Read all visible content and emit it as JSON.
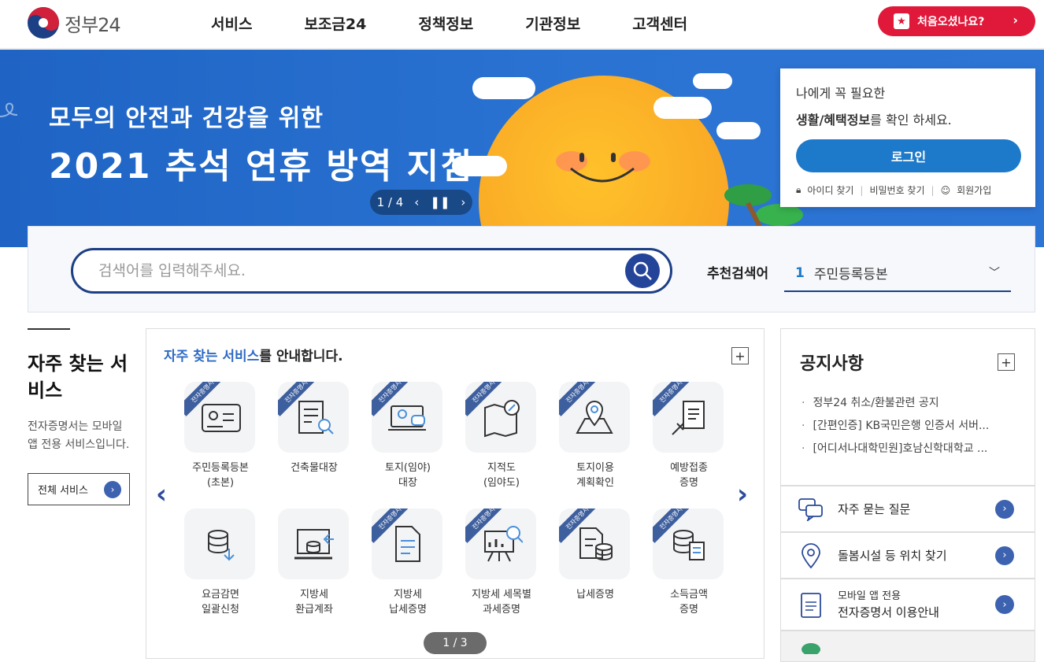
{
  "header": {
    "logo_text": "정부24",
    "nav": [
      "서비스",
      "보조금24",
      "정책정보",
      "기관정보",
      "고객센터"
    ],
    "first_visit_label": "처음오셨나요?"
  },
  "banner": {
    "title_line1": "모두의 안전과 건강을 위한",
    "title_line2": "2021 추석 연휴 방역 지침",
    "pager_text": "1 / 4"
  },
  "login": {
    "line1": "나에게 꼭 필요한",
    "line2_bold": "생활/혜택정보",
    "line2_rest": "를 확인 하세요.",
    "button": "로그인",
    "find_id": "아이디 찾기",
    "find_pw": "비밀번호 찾기",
    "signup": "회원가입"
  },
  "search": {
    "placeholder": "검색어를 입력해주세요.",
    "recommend_label": "추천검색어",
    "recommend_num": "1",
    "recommend_value": "주민등록등본"
  },
  "frequent": {
    "heading": "자주 찾는 서비스",
    "desc": "전자증명서는 모바일 앱 전용 서비스입니다.",
    "all_button": "전체 서비스"
  },
  "services": {
    "title_highlight": "자주 찾는 서비스",
    "title_rest": "를 안내합니다.",
    "badge_text": "전자증명서",
    "pager": "1 / 3",
    "items": [
      {
        "l1": "주민등록등본",
        "l2": "(초본)",
        "badge": true,
        "icon": "id-card-icon"
      },
      {
        "l1": "건축물대장",
        "l2": "",
        "badge": true,
        "icon": "document-search-icon"
      },
      {
        "l1": "토지(임야)",
        "l2": "대장",
        "badge": true,
        "icon": "laptop-map-icon"
      },
      {
        "l1": "지적도",
        "l2": "(임야도)",
        "badge": true,
        "icon": "map-compass-icon"
      },
      {
        "l1": "토지이용",
        "l2": "계획확인",
        "badge": true,
        "icon": "map-pin-icon"
      },
      {
        "l1": "예방접종",
        "l2": "증명",
        "badge": true,
        "icon": "syringe-icon"
      },
      {
        "l1": "요금감면",
        "l2": "일괄신청",
        "badge": false,
        "icon": "coins-down-icon"
      },
      {
        "l1": "지방세",
        "l2": "환급계좌",
        "badge": false,
        "icon": "coin-tray-icon"
      },
      {
        "l1": "지방세",
        "l2": "납세증명",
        "badge": true,
        "icon": "document-icon"
      },
      {
        "l1": "지방세 세목별",
        "l2": "과세증명",
        "badge": true,
        "icon": "chart-board-icon"
      },
      {
        "l1": "납세증명",
        "l2": "",
        "badge": true,
        "icon": "document-coins-icon"
      },
      {
        "l1": "소득금액",
        "l2": "증명",
        "badge": true,
        "icon": "coins-document-icon"
      }
    ]
  },
  "notice": {
    "heading": "공지사항",
    "items": [
      "정부24 취소/환불관련 공지",
      "[간편인증] KB국민은행 인증서 서버...",
      "[어디서나대학민원]호남신학대학교 ..."
    ]
  },
  "quick_links": [
    {
      "label": "자주 묻는 질문",
      "sub": "",
      "icon": "chat-bubbles-icon"
    },
    {
      "label": "돌봄시설 등 위치 찾기",
      "sub": "",
      "icon": "location-pin-icon"
    },
    {
      "label": "전자증명서 이용안내",
      "sub": "모바일 앱 전용",
      "icon": "certificate-icon"
    }
  ],
  "colors": {
    "brand_blue": "#1d3f85",
    "accent_red": "#e0193a",
    "banner_blue": "#2a73d2",
    "highlight_blue": "#2e6ac5"
  }
}
